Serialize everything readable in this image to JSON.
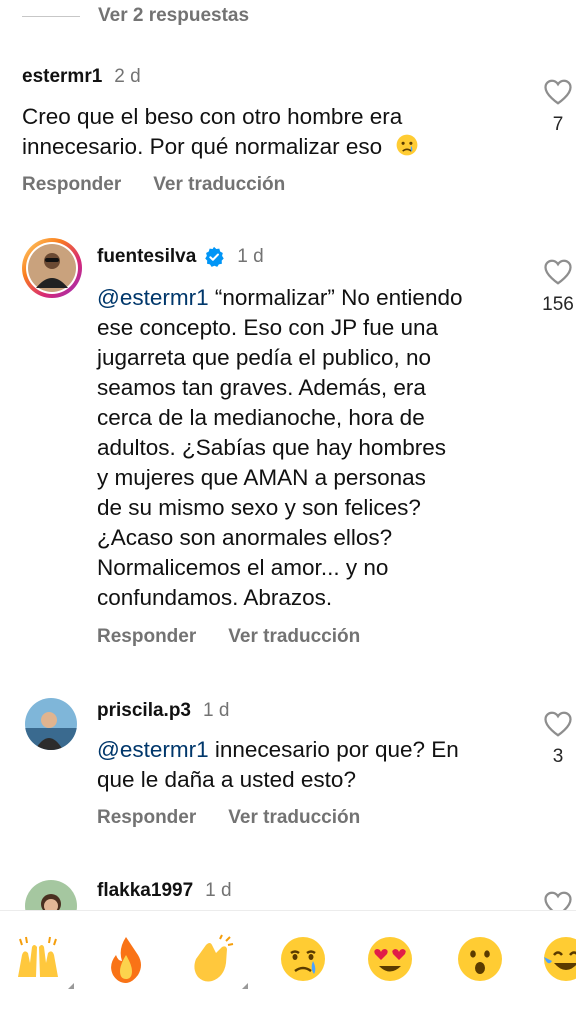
{
  "thread": {
    "view_replies": "Ver 2 respuestas"
  },
  "comments": [
    {
      "username": "estermr1",
      "time": "2 d",
      "text_lines": [
        "Creo que el beso con otro hombre era",
        "innecesario. Por qué normalizar eso"
      ],
      "emoji": "crying-face",
      "likes": "7",
      "reply_label": "Responder",
      "translate_label": "Ver traducción"
    },
    {
      "username": "fuentesilva",
      "verified": true,
      "time": "1 d",
      "mention": "@estermr1",
      "first_line_rest": " “normalizar” No entiendo",
      "text_lines": [
        "ese concepto. Eso con JP fue una",
        "jugarreta que pedía el publico, no",
        "seamos tan graves. Además, era",
        "cerca de la medianoche, hora de",
        "adultos. ¿Sabías que hay hombres",
        "y mujeres que AMAN a personas",
        "de su mismo sexo y son felices?",
        "¿Acaso son anormales ellos?",
        "Normalicemos el amor... y no",
        "confundamos. Abrazos."
      ],
      "likes": "156",
      "reply_label": "Responder",
      "translate_label": "Ver traducción"
    },
    {
      "username": "priscila.p3",
      "time": "1 d",
      "mention": "@estermr1",
      "first_line_rest": " innecesario por que? En",
      "text_lines": [
        "que le daña a usted esto?"
      ],
      "likes": "3",
      "reply_label": "Responder",
      "translate_label": "Ver traducción"
    },
    {
      "username": "flakka1997",
      "time": "1 d"
    }
  ],
  "reactions": [
    {
      "icon": "raising-hands-icon"
    },
    {
      "icon": "fire-icon"
    },
    {
      "icon": "clapping-hands-icon"
    },
    {
      "icon": "crying-face-icon"
    },
    {
      "icon": "heart-eyes-icon"
    },
    {
      "icon": "surprised-face-icon"
    },
    {
      "icon": "tears-of-joy-icon"
    }
  ],
  "colors": {
    "mention": "#00376b",
    "secondary_text": "#737373",
    "verified": "#0095f6"
  }
}
